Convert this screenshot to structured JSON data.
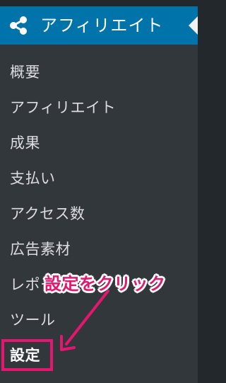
{
  "menu": {
    "title": "アフィリエイト",
    "icon": "share-icon",
    "items": [
      {
        "label": "概要"
      },
      {
        "label": "アフィリエイト"
      },
      {
        "label": "成果"
      },
      {
        "label": "支払い"
      },
      {
        "label": "アクセス数"
      },
      {
        "label": "広告素材"
      },
      {
        "label": "レポート"
      },
      {
        "label": "ツール"
      },
      {
        "label": "設定"
      }
    ]
  },
  "annotation": {
    "text": "設定をクリック",
    "color": "#e5166f"
  },
  "colors": {
    "header_bg": "#0073aa",
    "submenu_bg": "#32373c",
    "sidebar_bg": "#23282d"
  }
}
